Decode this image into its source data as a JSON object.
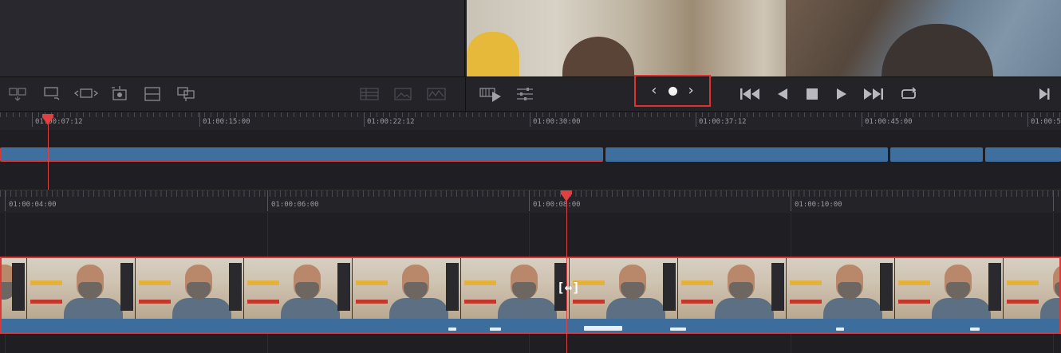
{
  "upper_timecodes": [
    "01:00:07:12",
    "01:00:15:00",
    "01:00:22:12",
    "01:00:30:00",
    "01:00:37:12",
    "01:00:45:00",
    "01:00:5"
  ],
  "lower_timecodes": [
    "01:00:04:00",
    "01:00:06:00",
    "01:00:08:00",
    "01:00:10:00"
  ],
  "transport": {
    "prev_symbol": "‹",
    "next_symbol": "›"
  },
  "colors": {
    "playhead": "#e04040",
    "clip_blue": "#3f6f9e",
    "selection_red": "#d83a3a"
  },
  "icons": {
    "left_toolbar": [
      "insert-clip-icon",
      "overwrite-clip-icon",
      "replace-clip-icon",
      "fit-to-fill-icon",
      "place-on-top-icon",
      "append-at-end-icon"
    ],
    "left_toolbar_dim": [
      "timeline-view-icon",
      "image-icon",
      "waveform-icon"
    ],
    "viewer_toolbar": [
      "bypass-playback-icon",
      "playback-settings-icon"
    ],
    "transport": [
      "go-to-start-icon",
      "play-reverse-icon",
      "stop-icon",
      "play-icon",
      "go-to-end-icon",
      "loop-icon",
      "next-frame-icon"
    ]
  }
}
